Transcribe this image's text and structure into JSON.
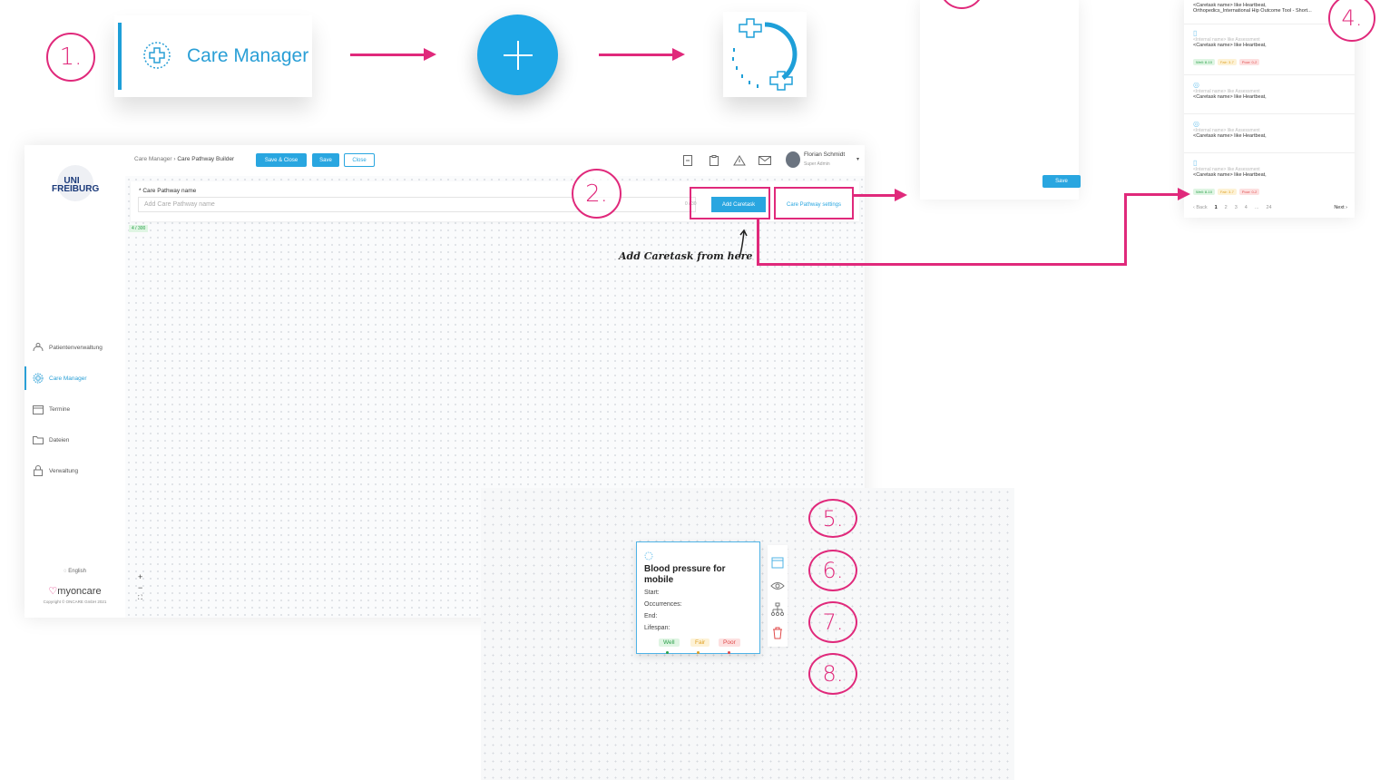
{
  "steps": {
    "s1": "1.",
    "s2": "2.",
    "s4": "4.",
    "s5": "5.",
    "s6": "6.",
    "s7": "7.",
    "s8": "8."
  },
  "care_manager_card": {
    "label": "Care Manager",
    "icon": "care-manager-icon"
  },
  "right_panel": {
    "top_line1": "<Caretask name> like Heartbeat,",
    "top_line2": "Orthopedics_International Hip Outcome Tool - Short...",
    "items": [
      {
        "internal": "<Internal name> like Assessment",
        "name": "<Caretask name> like Heartbeat,",
        "icon": "clipboard-icon",
        "tags": true
      },
      {
        "internal": "<Internal name> like Assessment",
        "name": "<Caretask name> like Heartbeat,",
        "icon": "care-task-icon",
        "tags": false
      },
      {
        "internal": "<Internal name> like Assessment",
        "name": "<Caretask name> like Heartbeat,",
        "icon": "care-task-icon",
        "tags": false
      },
      {
        "internal": "<Internal name> like Assessment",
        "name": "<Caretask name> like Heartbeat,",
        "icon": "clipboard-icon",
        "tags": true
      }
    ],
    "tags": {
      "well": "Well: 8-10",
      "fair": "Fair: 3-7",
      "poor": "Poor: 0-2"
    },
    "pager": {
      "back": "Back",
      "pages": [
        "1",
        "2",
        "3",
        "4",
        "...",
        "24"
      ],
      "next": "Next"
    }
  },
  "left_panel": {
    "save": "Save"
  },
  "app": {
    "logo": "UNI FREIBURG",
    "nav": [
      {
        "label": "Patientenverwaltung",
        "icon": "patients-icon"
      },
      {
        "label": "Care Manager",
        "icon": "care-manager-icon"
      },
      {
        "label": "Termine",
        "icon": "calendar-icon"
      },
      {
        "label": "Dateien",
        "icon": "folder-icon"
      },
      {
        "label": "Verwaltung",
        "icon": "lock-icon"
      }
    ],
    "language": "English",
    "brand": "myoncare",
    "copyright": "Copyright © ONCARE GmbH 2021",
    "breadcrumb": {
      "root": "Care Manager",
      "sep": "›",
      "current": "Care Pathway Builder"
    },
    "buttons": {
      "save_close": "Save & Close",
      "save": "Save",
      "close": "Close"
    },
    "user": {
      "name": "Florian Schmidt",
      "role": "Super Admin"
    },
    "form": {
      "label": "* Care Pathway name",
      "placeholder": "Add Care Pathway name",
      "counter": "0 / 30",
      "add_caretask": "Add Caretask",
      "settings": "Care Pathway settings"
    },
    "badge": "4 / 300",
    "zoom": {
      "in": "+",
      "out": "−",
      "fit": "⛶"
    }
  },
  "hint": "Add Caretask from here",
  "task_card": {
    "title": "Blood pressure for mobile",
    "fields": [
      "Start:",
      "Occurrences:",
      "End:",
      "Lifespan:"
    ],
    "tags": {
      "well": "Well",
      "fair": "Fair",
      "poor": "Poor"
    }
  },
  "colors": {
    "accent": "#e0297b",
    "primary": "#29a6e0",
    "well": "#2aa04a",
    "fair": "#e0a024",
    "poor": "#e04a4a"
  }
}
